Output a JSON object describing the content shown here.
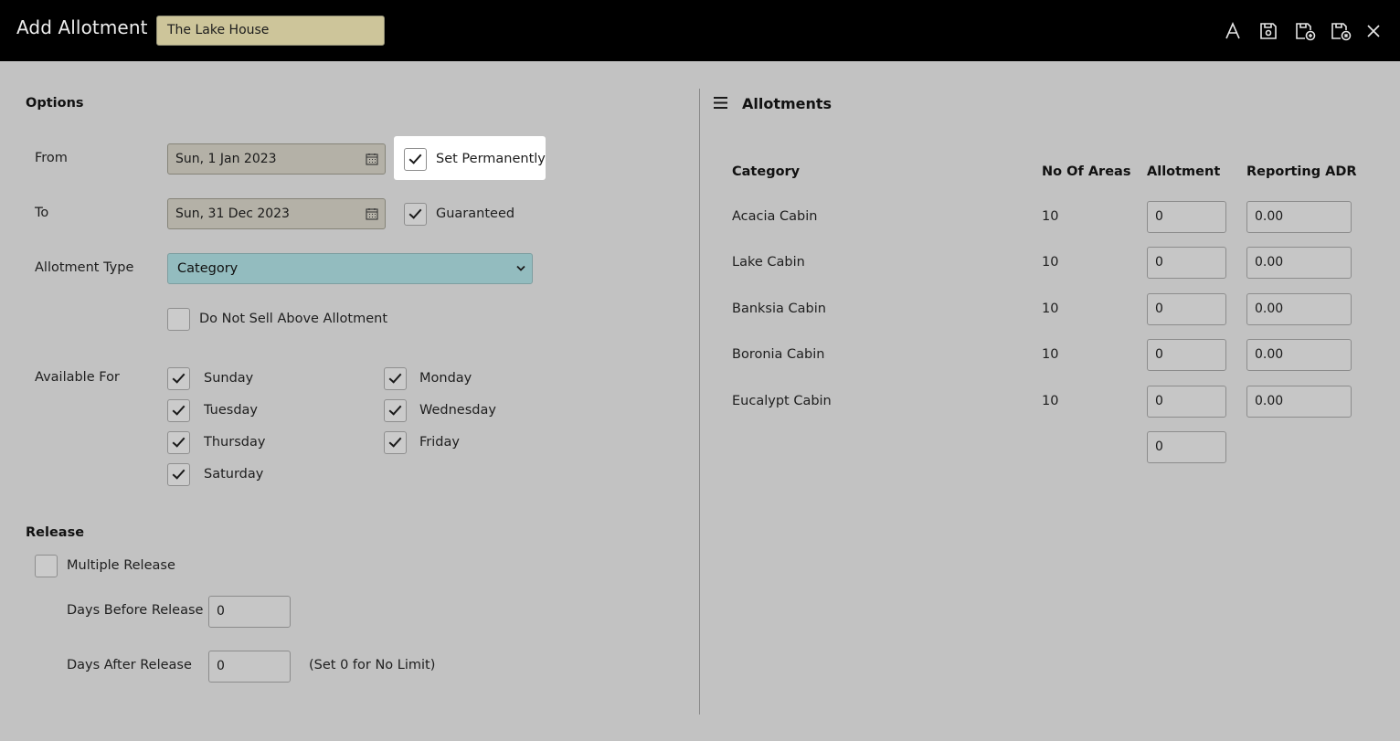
{
  "header": {
    "title": "Add Allotment",
    "name_value": "The Lake House",
    "icons": [
      "font-icon",
      "save-icon",
      "save-add-icon",
      "save-close-icon",
      "close-icon"
    ]
  },
  "options": {
    "section_title": "Options",
    "from_label": "From",
    "from_value": "Sun, 1 Jan 2023",
    "set_permanently_label": "Set Permanently",
    "set_permanently_checked": true,
    "to_label": "To",
    "to_value": "Sun, 31 Dec 2023",
    "guaranteed_label": "Guaranteed",
    "guaranteed_checked": true,
    "type_label": "Allotment Type",
    "type_value": "Category",
    "do_not_sell_label": "Do Not Sell Above Allotment",
    "do_not_sell_checked": false,
    "available_label": "Available For",
    "days": [
      {
        "label": "Sunday",
        "checked": true
      },
      {
        "label": "Monday",
        "checked": true
      },
      {
        "label": "Tuesday",
        "checked": true
      },
      {
        "label": "Wednesday",
        "checked": true
      },
      {
        "label": "Thursday",
        "checked": true
      },
      {
        "label": "Friday",
        "checked": true
      },
      {
        "label": "Saturday",
        "checked": true
      }
    ]
  },
  "release": {
    "section_title": "Release",
    "multiple_label": "Multiple Release",
    "multiple_checked": false,
    "days_before_label": "Days Before Release",
    "days_before_value": "0",
    "days_after_label": "Days After Release",
    "days_after_value": "0",
    "hint": "(Set 0 for No Limit)"
  },
  "allotments": {
    "title": "Allotments",
    "columns": [
      "Category",
      "No Of Areas",
      "Allotment",
      "Reporting ADR"
    ],
    "rows": [
      {
        "category": "Acacia Cabin",
        "areas": "10",
        "allotment": "0",
        "adr": "0.00"
      },
      {
        "category": "Lake Cabin",
        "areas": "10",
        "allotment": "0",
        "adr": "0.00"
      },
      {
        "category": "Banksia Cabin",
        "areas": "10",
        "allotment": "0",
        "adr": "0.00"
      },
      {
        "category": "Boronia Cabin",
        "areas": "10",
        "allotment": "0",
        "adr": "0.00"
      },
      {
        "category": "Eucalypt Cabin",
        "areas": "10",
        "allotment": "0",
        "adr": "0.00"
      }
    ],
    "total_allotment": "0"
  }
}
